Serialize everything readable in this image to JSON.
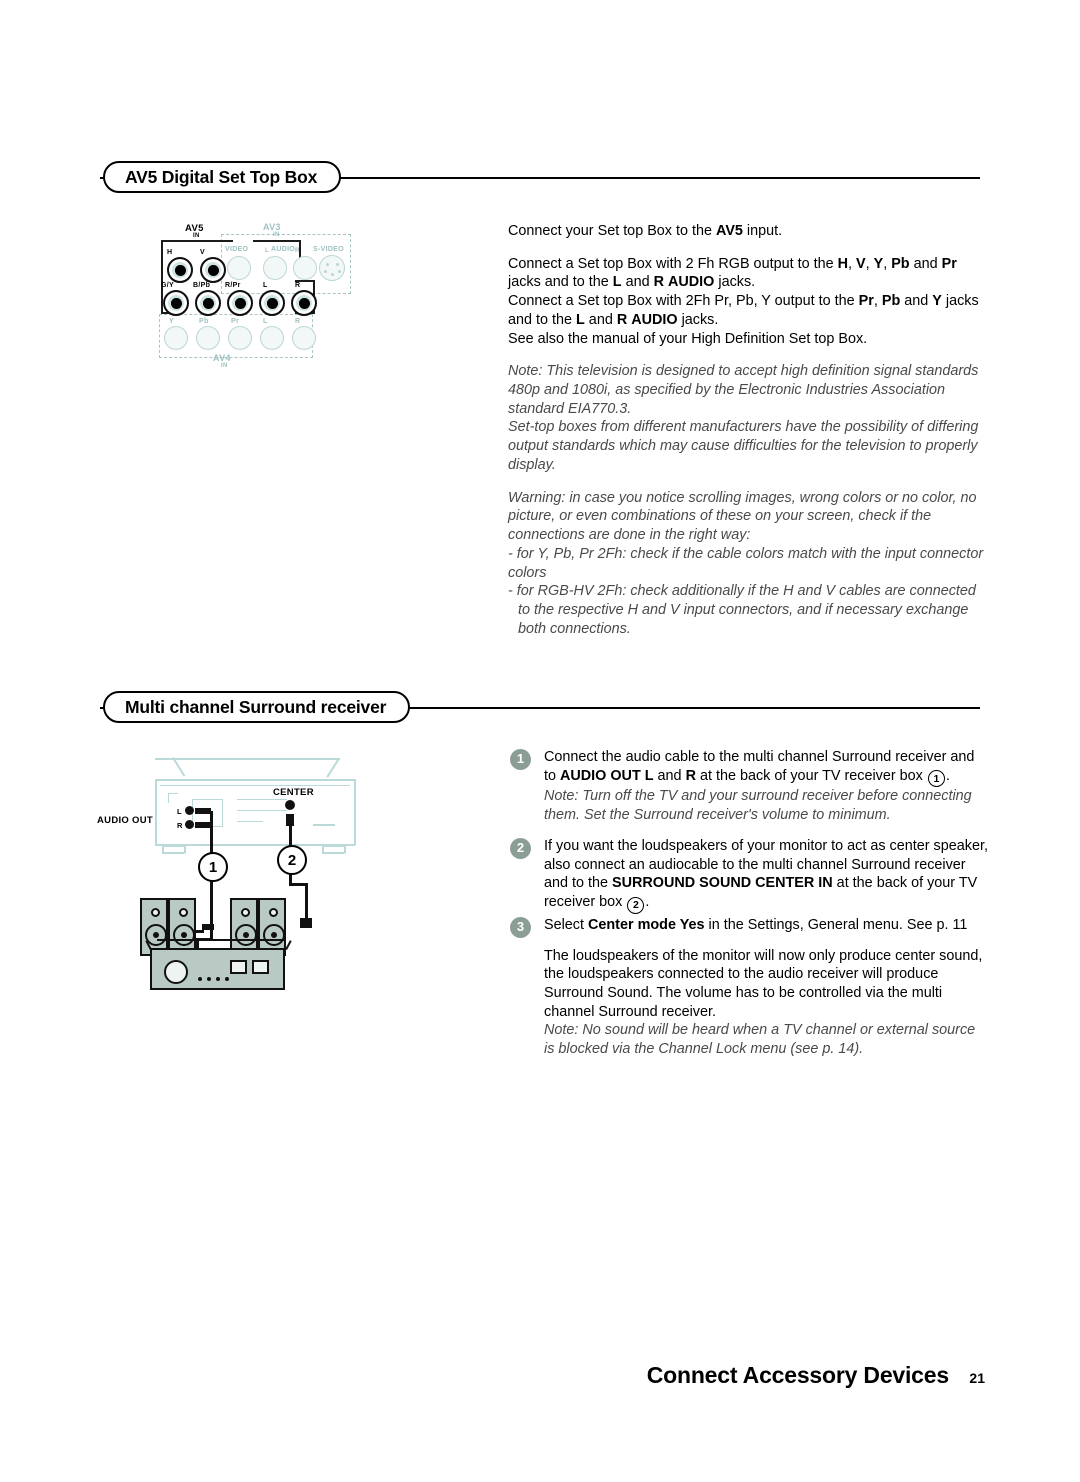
{
  "sections": [
    {
      "id": "av5",
      "heading": "AV5 Digital Set Top Box",
      "paragraphs": [
        "Connect your Set top Box to the AV5 input.",
        "Connect a Set top Box with 2 Fh RGB output to the H, V, Y, Pb and Pr jacks and to the L and R AUDIO jacks.",
        "Connect a Set top Box with 2Fh Pr, Pb, Y output to the Pr, Pb and Y jacks and to the L and R AUDIO jacks.",
        "See also the manual of your High Definition Set top Box.",
        "Note: This television is designed to accept high definition signal standards 480p and 1080i, as specified by the Electronic Industries Association standard EIA770.3.",
        "Set-top boxes from different manufacturers have the possibility of differing output standards which may cause difficulties for the television to properly display.",
        "Warning: in case you notice scrolling images, wrong colors or no color, no picture, or even combinations of these on your screen, check if the connections are done in the right way:",
        "- for Y, Pb, Pr 2Fh: check if the cable colors match with the input connector colors",
        "- for RGB-HV 2Fh: check additionally if the H and V cables are connected to the respective H and V input connectors, and if necessary exchange both connections."
      ]
    },
    {
      "id": "surround",
      "heading": "Multi channel Surround receiver",
      "steps": [
        {
          "number": "1",
          "text": "Connect the audio cable to the multi channel Surround receiver and to AUDIO OUT L and R at the back of your TV receiver box ①.",
          "note": "Note: Turn off the TV and your surround receiver before connecting them. Set the Surround receiver's volume to minimum."
        },
        {
          "number": "2",
          "text": "If you want the loudspeakers of your monitor to act as center speaker, also connect an audiocable to the multi channel Surround receiver and to the SURROUND SOUND CENTER IN at the back of your TV receiver box ②."
        },
        {
          "number": "3",
          "text": "Select Center mode Yes in the Settings, General menu. See p. 11",
          "body": "The loudspeakers of the monitor will now only produce center sound, the loudspeakers connected to the audio receiver will produce Surround Sound. The volume has to be controlled via the multi channel Surround receiver.",
          "note": "Note: No sound will be heard when a TV channel or external source is blocked via the Channel Lock menu (see p. 14)."
        }
      ]
    }
  ],
  "jack_panel": {
    "group_av5": "AV5",
    "group_av5_in": "IN",
    "group_av3": "AV3",
    "group_av3_in": "IN",
    "group_av4": "AV4",
    "group_av4_in": "IN",
    "av3_labels": {
      "video": "VIDEO",
      "audio_l": "L",
      "audio": "AUDIO",
      "audio_r": "R",
      "svideo": "S-VIDEO"
    },
    "av5_top": [
      "H",
      "V"
    ],
    "av5_bottom": [
      "G/Y",
      "B/Pb",
      "R/Pr",
      "L",
      "R"
    ],
    "av4_labels": [
      "Y",
      "Pb",
      "Pr",
      "L",
      "R"
    ]
  },
  "surround_diagram": {
    "audio_out_label": "AUDIO OUT",
    "audio_out_l": "L",
    "audio_out_r": "R",
    "center_label": "CENTER",
    "cable_1": "1",
    "cable_2": "2"
  },
  "footer": {
    "title": "Connect Accessory Devices",
    "page": "21"
  },
  "colors": {
    "accent_teal": "#bcd9d9",
    "bullet_green": "#8b9e96",
    "speaker_body": "#b9c9c3",
    "ink": "#000000"
  }
}
